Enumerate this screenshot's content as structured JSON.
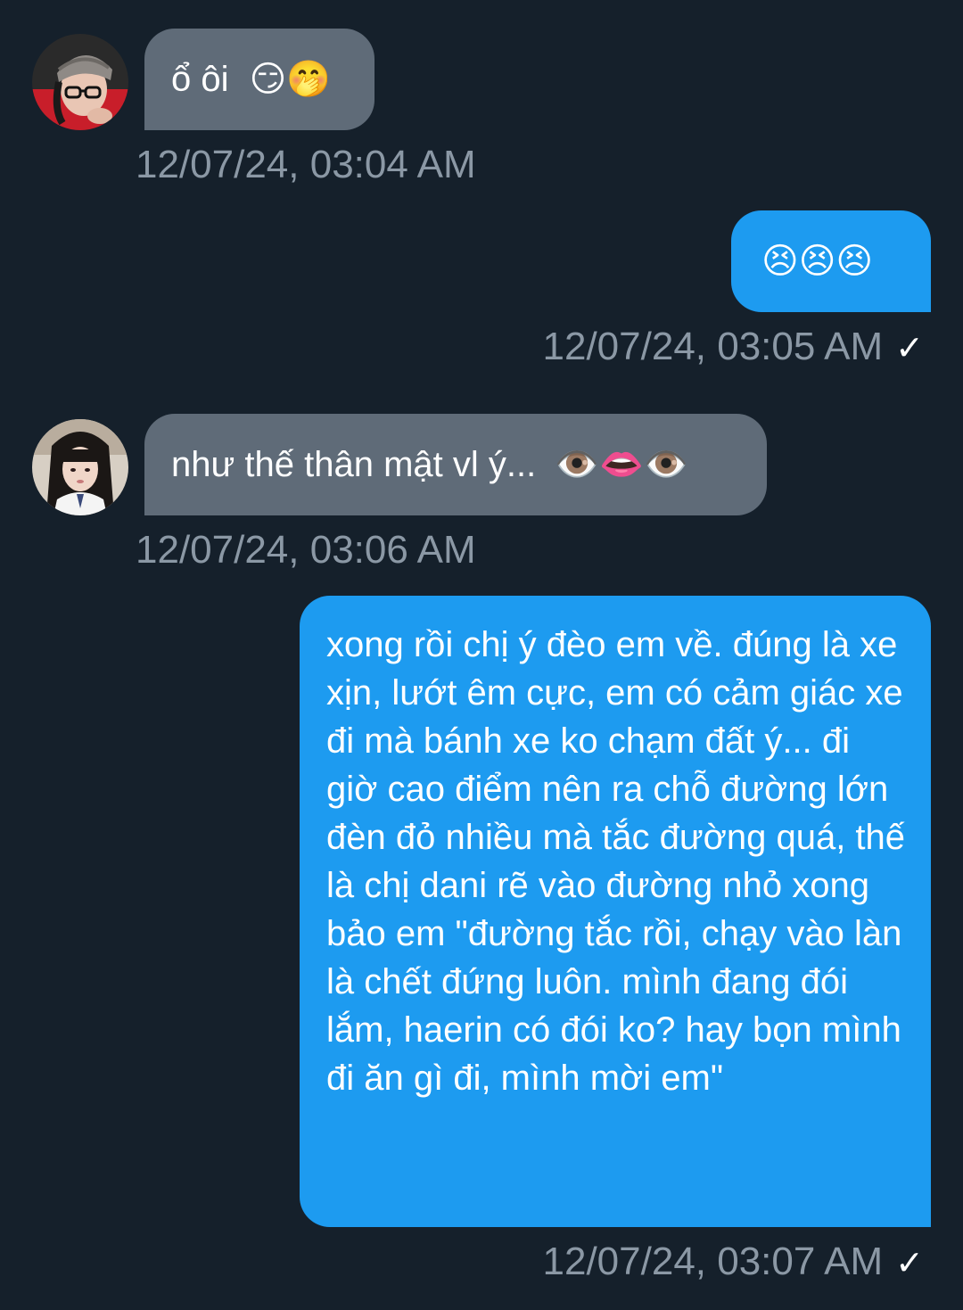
{
  "messages": [
    {
      "direction": "incoming",
      "text": "ổ ôi",
      "emoji": "😏🤭",
      "timestamp": "12/07/24, 03:04 AM"
    },
    {
      "direction": "outgoing",
      "text": "",
      "emoji": "😣😣😣",
      "timestamp": "12/07/24, 03:05 AM",
      "status": "✓"
    },
    {
      "direction": "incoming",
      "text": "như thế thân mật vl ý...",
      "emoji": "👁️👄👁️",
      "timestamp": "12/07/24, 03:06 AM"
    },
    {
      "direction": "outgoing",
      "text": "xong rồi chị ý đèo em về. đúng là xe xịn, lướt êm cực, em có cảm giác xe đi mà bánh xe ko chạm đất ý... đi giờ cao điểm nên ra chỗ đường lớn đèn đỏ nhiều mà tắc đường quá, thế là chị dani rẽ vào đường nhỏ xong bảo em \"đường tắc rồi, chạy vào làn là chết đứng luôn. mình đang đói lắm, haerin có đói ko? hay bọn mình đi ăn gì đi, mình mời em\"",
      "timestamp": "12/07/24, 03:07 AM",
      "status": "✓"
    }
  ],
  "colors": {
    "background": "#15202b",
    "incoming_bubble": "#5f6b78",
    "outgoing_bubble": "#1d9bf0",
    "timestamp": "#8b98a5"
  }
}
